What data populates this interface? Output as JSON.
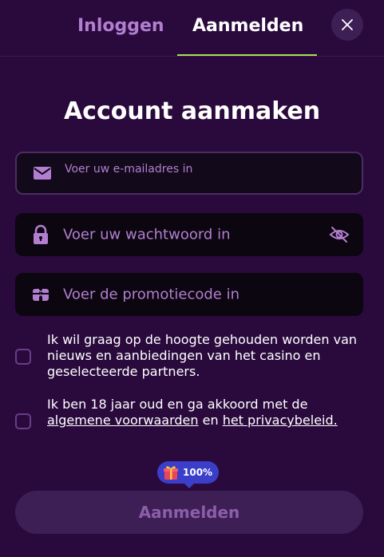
{
  "tabs": {
    "login": "Inloggen",
    "register": "Aanmelden"
  },
  "title": "Account aanmaken",
  "fields": {
    "email_placeholder": "Voer uw e-mailadres in",
    "password_placeholder": "Voer uw wachtwoord in",
    "promo_placeholder": "Voer de promotiecode in"
  },
  "checks": {
    "newsletter": "Ik wil graag op de hoogte gehouden worden van nieuws en aanbiedingen van het casino en geselecteerde partners.",
    "terms_prefix": "Ik ben 18 jaar oud en ga akkoord met de",
    "terms_link": "algemene voorwaarden",
    "terms_and": "en",
    "privacy_link": "het privacybeleid."
  },
  "badge": {
    "value": "100%"
  },
  "submit_label": "Aanmelden",
  "icons": [
    "close-icon",
    "mail-icon",
    "lock-icon",
    "eye-off-icon",
    "gift-icon"
  ],
  "colors": {
    "background": "#2a0a3d",
    "accent": "#b27fd0",
    "tab_underline": "#a8e04c",
    "badge": "#3b3ec8"
  }
}
